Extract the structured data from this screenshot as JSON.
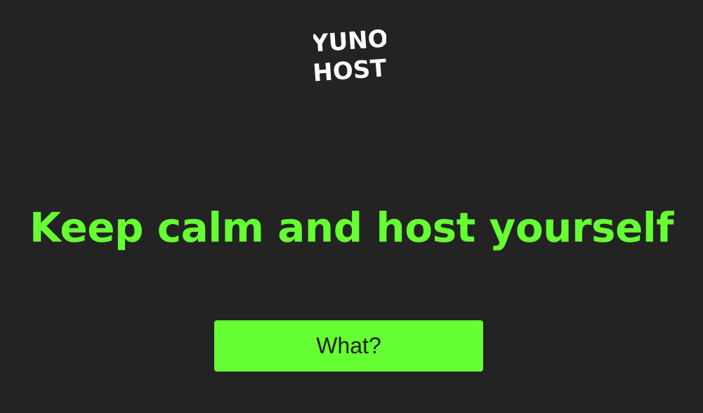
{
  "logo": {
    "icon": "yunohost-logo-icon",
    "line1": "YUNO",
    "line2": "HOST",
    "color": "#ffffff"
  },
  "headline": {
    "text": "Keep calm and host yourself",
    "color": "#66ff33"
  },
  "cta": {
    "label": "What?",
    "background": "#66ff33",
    "text_color": "#1f1f1f"
  },
  "theme": {
    "background": "#232323"
  }
}
